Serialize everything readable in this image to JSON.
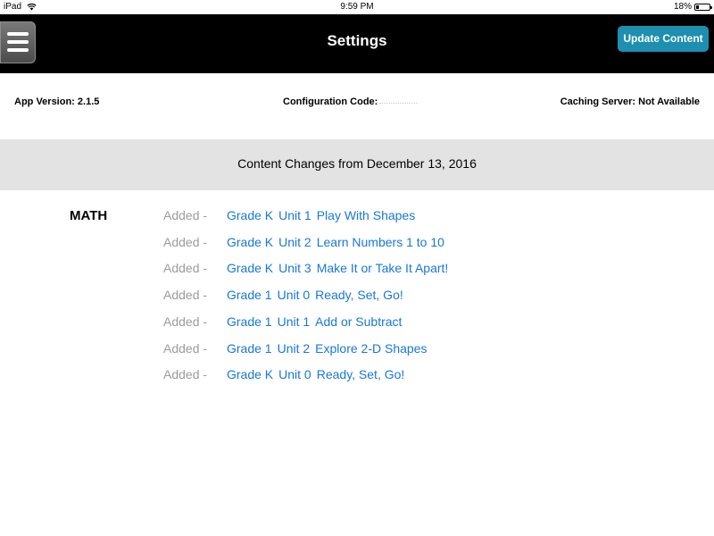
{
  "status_bar": {
    "device": "iPad",
    "time": "9:59 PM",
    "battery": "18%",
    "battery_level": 0.18
  },
  "header": {
    "title": "Settings",
    "update_button_label": "Update Content"
  },
  "info": {
    "app_version": "App Version: 2.1.5",
    "configuration_code_label": "Configuration Code:",
    "caching_server": "Caching Server: Not Available"
  },
  "changes_banner": "Content Changes from December 13, 2016",
  "subject": "MATH",
  "changes": [
    {
      "status": "Added -",
      "grade": "Grade K",
      "unit": "Unit 1",
      "title": "Play With Shapes"
    },
    {
      "status": "Added -",
      "grade": "Grade K",
      "unit": "Unit 2",
      "title": "Learn Numbers 1 to 10"
    },
    {
      "status": "Added -",
      "grade": "Grade K",
      "unit": "Unit 3",
      "title": "Make It or Take It Apart!"
    },
    {
      "status": "Added -",
      "grade": "Grade 1",
      "unit": "Unit 0",
      "title": "Ready, Set, Go!"
    },
    {
      "status": "Added -",
      "grade": "Grade 1",
      "unit": "Unit 1",
      "title": "Add or Subtract"
    },
    {
      "status": "Added -",
      "grade": "Grade 1",
      "unit": "Unit 2",
      "title": "Explore 2-D Shapes"
    },
    {
      "status": "Added -",
      "grade": "Grade K",
      "unit": "Unit 0",
      "title": "Ready, Set, Go!"
    }
  ],
  "colors": {
    "header_bg": "#000000",
    "update_button_bg": "#1e8fb0",
    "banner_bg": "#e3e3e3",
    "link": "#1877d9",
    "status_text": "#9b9b9b"
  },
  "icons": {
    "menu": "hamburger-menu-icon",
    "wifi": "wifi-icon",
    "battery": "battery-icon"
  }
}
